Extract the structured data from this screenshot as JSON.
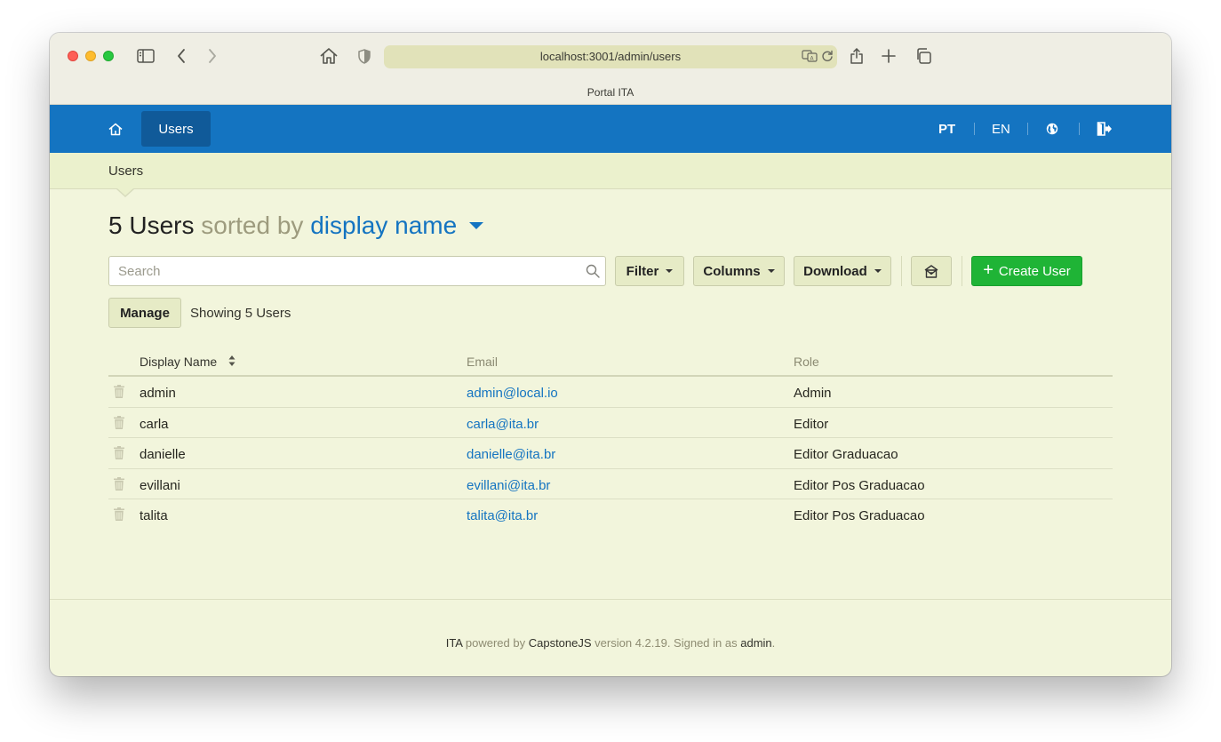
{
  "browser": {
    "url": "localhost:3001/admin/users",
    "tab_title": "Portal ITA"
  },
  "header": {
    "nav_users": "Users",
    "lang_pt": "PT",
    "lang_en": "EN"
  },
  "breadcrumb": "Users",
  "page_title": {
    "count": "5 Users",
    "sorted_by": "sorted by",
    "field": "display name"
  },
  "toolbar": {
    "search_placeholder": "Search",
    "filter": "Filter",
    "columns": "Columns",
    "download": "Download",
    "create_user": "Create User",
    "manage": "Manage",
    "showing": "Showing 5 Users"
  },
  "table": {
    "headers": {
      "display_name": "Display Name",
      "email": "Email",
      "role": "Role"
    },
    "rows": [
      {
        "name": "admin",
        "email": "admin@local.io",
        "role": "Admin"
      },
      {
        "name": "carla",
        "email": "carla@ita.br",
        "role": "Editor"
      },
      {
        "name": "danielle",
        "email": "danielle@ita.br",
        "role": "Editor Graduacao"
      },
      {
        "name": "evillani",
        "email": "evillani@ita.br",
        "role": "Editor Pos Graduacao"
      },
      {
        "name": "talita",
        "email": "talita@ita.br",
        "role": "Editor Pos Graduacao"
      }
    ]
  },
  "footer": {
    "brand": "ITA",
    "powered_by": "powered by",
    "framework": "CapstoneJS",
    "version_text": "version 4.2.19. Signed in as",
    "user": "admin",
    "period": "."
  },
  "colors": {
    "header_blue": "#1474c1",
    "page_bg": "#f2f5dc",
    "create_green": "#1fb436",
    "link_blue": "#1474c1"
  }
}
